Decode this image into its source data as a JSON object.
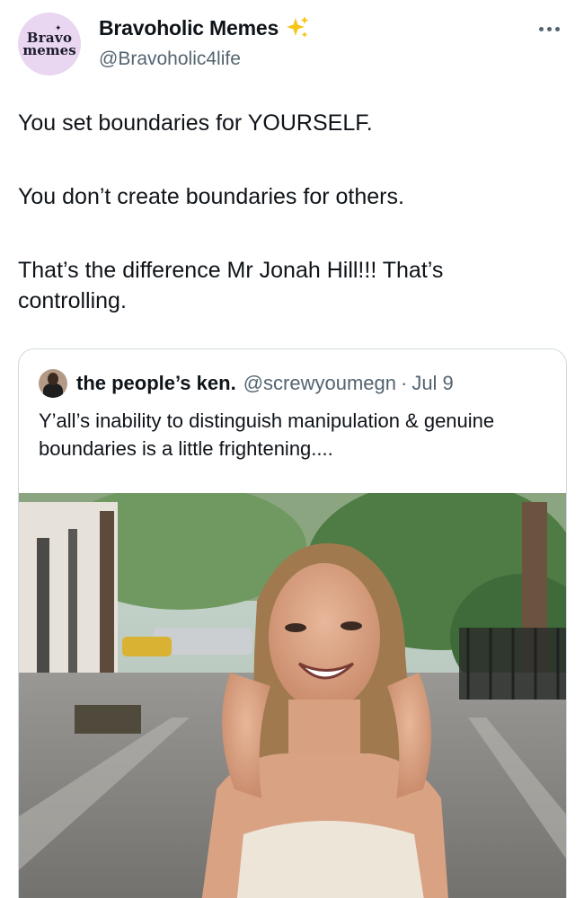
{
  "author": {
    "avatar_text_line1": "Bravo",
    "avatar_text_line2": "memes",
    "display_name": "Bravoholic Memes",
    "handle": "@Bravoholic4life",
    "verified_emoji": "sparkles-icon"
  },
  "tweet": {
    "paragraphs": [
      "You set boundaries for YOURSELF.",
      "You don’t create boundaries for others.",
      "That’s the difference Mr Jonah Hill!!! That’s controlling."
    ]
  },
  "quoted_tweet": {
    "display_name": "the people’s ken.",
    "handle": "@screwyoumegn",
    "separator": "·",
    "date": "Jul 9",
    "text": "Y’all’s inability to distinguish manipulation & genuine boundaries is a little frightening....",
    "media": "photo-of-woman-laughing-on-sidewalk"
  },
  "colors": {
    "text": "#0f1419",
    "secondary": "#536471",
    "border": "#cfd9de",
    "avatar_bg": "#e9d7f2",
    "sparkle": "#f5c518"
  }
}
